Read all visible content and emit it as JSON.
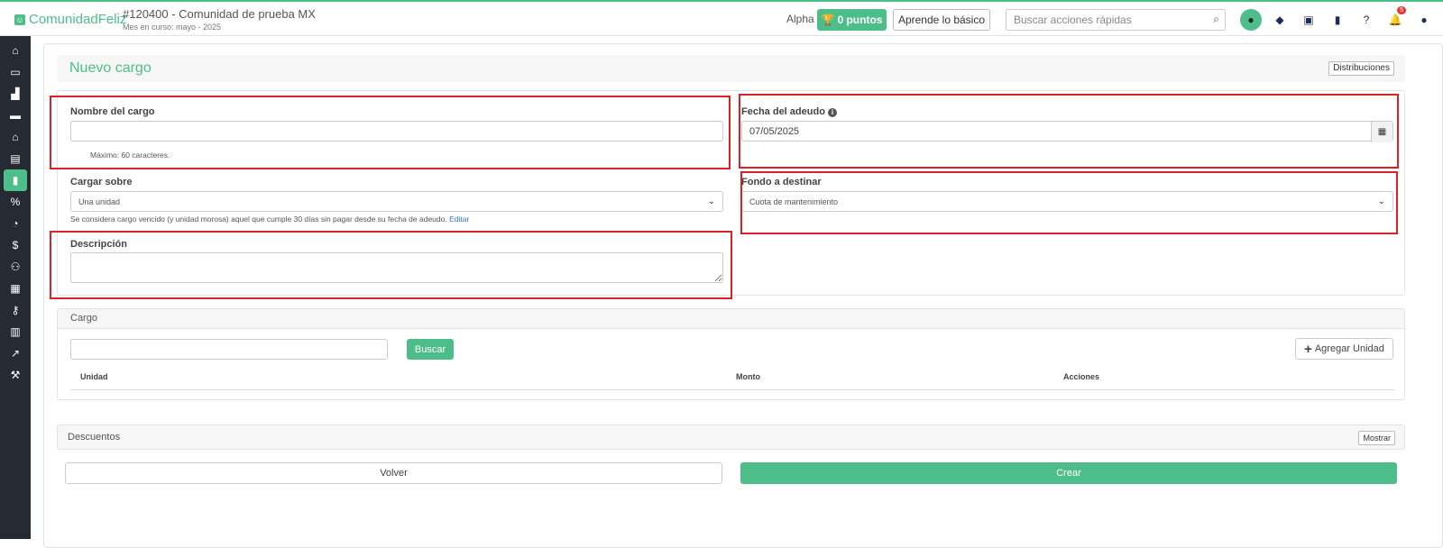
{
  "header": {
    "logo_text": "ComunidadFeliz",
    "community_name": "#120400 - Comunidad de prueba MX",
    "month_label": "Mes en curso: mayo - 2025",
    "alpha_label": "Alpha",
    "points_label": "0 puntos",
    "learn_label": "Aprende lo básico",
    "search_placeholder": "Buscar acciones rápidas",
    "notification_count": "5",
    "accent_color": "#4dbe8a"
  },
  "sidebar": {
    "items": [
      {
        "icon": "home-icon"
      },
      {
        "icon": "cash-icon"
      },
      {
        "icon": "chart-area-icon"
      },
      {
        "icon": "credit-card-icon"
      },
      {
        "icon": "bank-icon"
      },
      {
        "icon": "file-icon"
      },
      {
        "icon": "book-icon"
      },
      {
        "icon": "percent-icon"
      },
      {
        "icon": "gauge-icon"
      },
      {
        "icon": "dollar-icon"
      },
      {
        "icon": "users-icon"
      },
      {
        "icon": "photo-icon"
      },
      {
        "icon": "key-icon"
      },
      {
        "icon": "calculator-icon"
      },
      {
        "icon": "line-chart-icon"
      },
      {
        "icon": "wrench-icon"
      }
    ]
  },
  "page": {
    "title": "Nuevo cargo",
    "distribuciones_label": "Distribuciones"
  },
  "form": {
    "nombre_label": "Nombre del cargo",
    "nombre_value": "",
    "nombre_hint": "Máximo: 60 caracteres.",
    "fecha_label": "Fecha del adeudo",
    "fecha_value": "07/05/2025",
    "cargar_sobre_label": "Cargar sobre",
    "cargar_sobre_value": "Una unidad",
    "vencido_hint": "Se considera cargo vencido (y unidad morosa) aquel que cumple 30 días sin pagar desde su fecha de adeudo.",
    "editar_link": "Editar",
    "fondo_label": "Fondo a destinar",
    "fondo_value": "Cuota de mantenimiento",
    "descripcion_label": "Descripción",
    "descripcion_value": ""
  },
  "cargo": {
    "section_title": "Cargo",
    "search_value": "",
    "buscar_label": "Buscar",
    "agregar_label": "Agregar Unidad",
    "columns": [
      "Unidad",
      "Monto",
      "Acciones"
    ]
  },
  "descuentos": {
    "title": "Descuentos",
    "mostrar_label": "Mostrar"
  },
  "actions": {
    "volver_label": "Volver",
    "crear_label": "Crear"
  }
}
